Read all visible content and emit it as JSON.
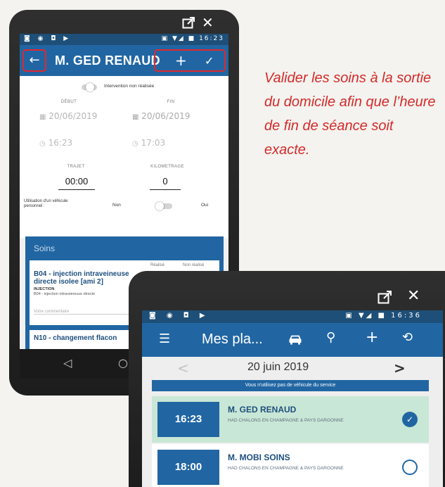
{
  "phone1": {
    "window_icons": {
      "popout": "popout-icon",
      "close": "close-icon"
    },
    "status_bar": {
      "left_icons": "◙ ◉ ◘ ▶",
      "right_icons": "▣ ▼◢ ■",
      "time": "16:23"
    },
    "app_bar": {
      "back": "←",
      "title": "M. GED RENAUD",
      "add": "+",
      "validate": "✓"
    },
    "form": {
      "intervention_toggle_label": "Intervention non réalisée",
      "debut_label": "DÉBUT",
      "fin_label": "FIN",
      "debut_date": "20/06/2019",
      "fin_date": "20/06/2019",
      "debut_time": "16:23",
      "fin_time": "17:03",
      "trajet_label": "TRAJET",
      "km_label": "KILOMETRAGE",
      "trajet_value": "00:00",
      "km_value": "0",
      "vehicle_question": "Utilisation d'un véhicule personnel :",
      "vehicle_no": "Non",
      "vehicle_yes": "Oui"
    },
    "soins": {
      "title": "Soins",
      "realise_label": "Réalisé",
      "non_realise_label": "Non réalisé",
      "item1_title": "B04 - injection intraveineuse directe isolee [ami 2]",
      "item1_category": "INJECTION",
      "item1_desc": "B04 - injection intraveineuse directe",
      "item1_comment_placeholder": "Votre commentaire",
      "item2_title": "N10 - changement flacon"
    },
    "nav": {
      "back": "◁",
      "home": "○"
    }
  },
  "instruction": "Valider les soins à la sortie du domicile afin que l’heure de fin de séance soit exacte.",
  "phone2": {
    "window_icons": {
      "popout": "popout-icon",
      "close": "close-icon"
    },
    "status_bar": {
      "left_icons": "◙ ◉ ◘ ▶",
      "right_icons": "▣ ▼◢ ■",
      "time": "16:36"
    },
    "app_bar": {
      "menu": "☰",
      "title": "Mes pla...",
      "car": "car-icon",
      "search": "⚲",
      "add": "+",
      "sync": "⟲"
    },
    "date": {
      "prev": "<",
      "label": "20 juin 2019",
      "next": ">"
    },
    "vehicle_banner": "Vous n'utilisez pas de véhicule du service",
    "appointments": [
      {
        "time": "16:23",
        "name": "M. GED RENAUD",
        "org": "HAD CHALONS EN CHAMPAGNE & PAYS DARGONNE",
        "status": "done",
        "bg": "#c9e7d6"
      },
      {
        "time": "18:00",
        "name": "M. MOBI SOINS",
        "org": "HAD CHALONS EN CHAMPAGNE & PAYS DARGONNE",
        "status": "todo",
        "bg": "#ffffff"
      }
    ]
  },
  "colors": {
    "primary": "#2166a3",
    "highlight_red": "#e0282d",
    "instruction_red": "#d42a2a",
    "done_row": "#c9e7d6"
  }
}
